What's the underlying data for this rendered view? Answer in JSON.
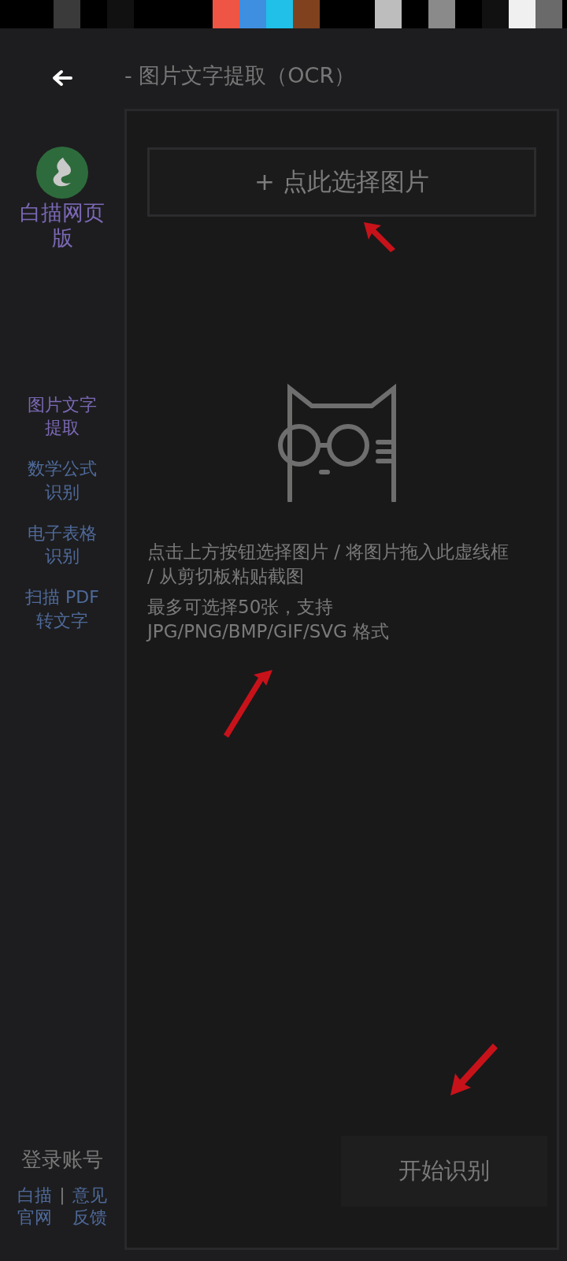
{
  "header": {
    "title": "- 图片文字提取（OCR）"
  },
  "sidebar": {
    "brand": "白描网页版",
    "items": [
      {
        "label": "图片文字提取",
        "selected": true
      },
      {
        "label": "数学公式识别",
        "selected": false
      },
      {
        "label": "电子表格识别",
        "selected": false
      },
      {
        "label": "扫描 PDF 转文字",
        "selected": false
      }
    ],
    "login": "登录账号",
    "links": [
      "白描官网",
      "意见反馈"
    ],
    "separator": "|"
  },
  "upload": {
    "button": "+ 点此选择图片",
    "hints": [
      "点击上方按钮选择图片 / 将图片拖入此虚线框 / 从剪切板粘贴截图",
      "最多可选择50张，支持 JPG/PNG/BMP/GIF/SVG 格式"
    ],
    "start_button": "开始识别"
  }
}
